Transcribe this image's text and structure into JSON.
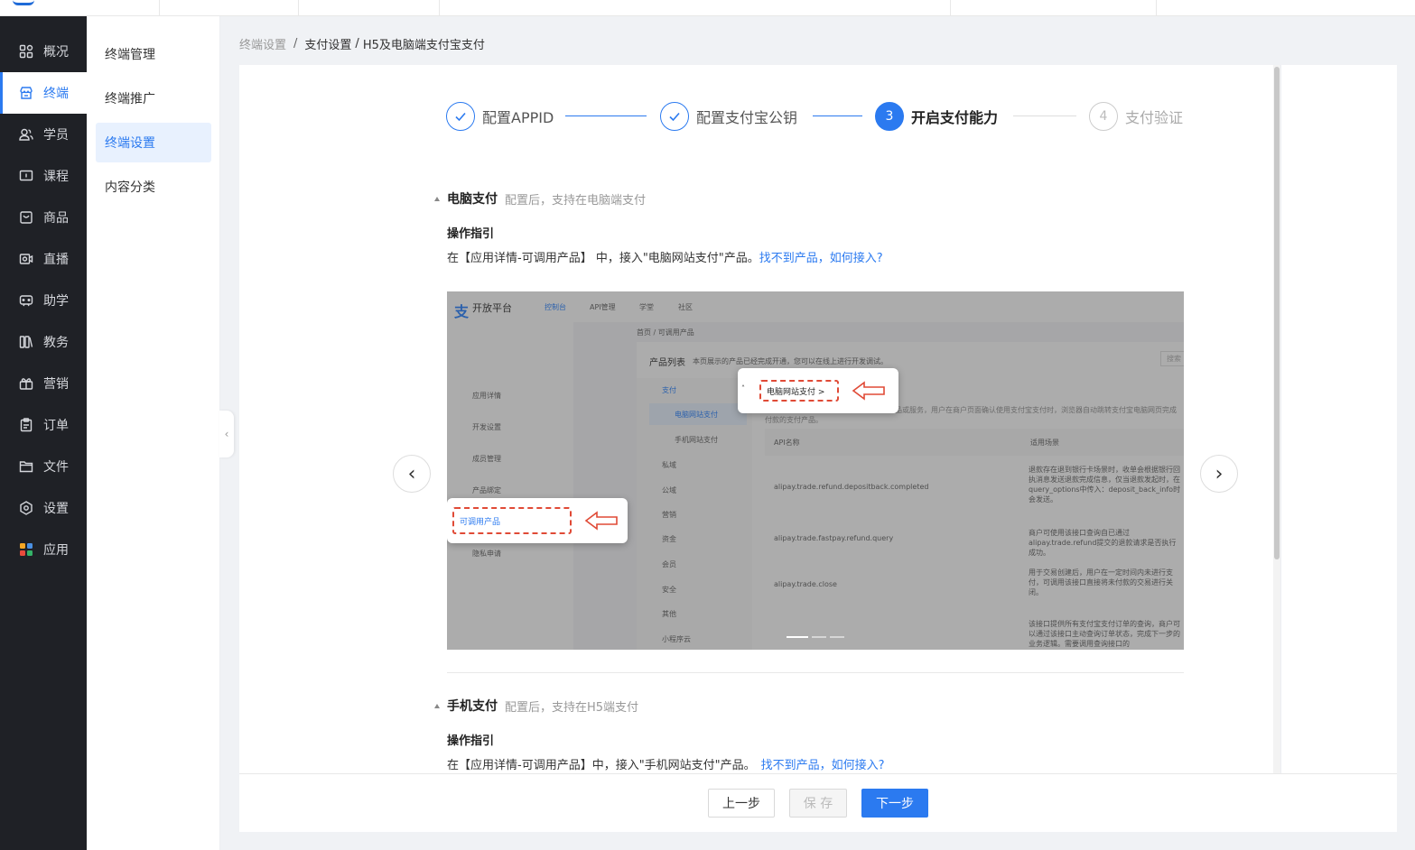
{
  "sidebar": {
    "items": [
      {
        "label": "概况",
        "icon": "grid-icon"
      },
      {
        "label": "终端",
        "icon": "store-icon"
      },
      {
        "label": "学员",
        "icon": "users-icon"
      },
      {
        "label": "课程",
        "icon": "course-icon"
      },
      {
        "label": "商品",
        "icon": "bag-icon"
      },
      {
        "label": "直播",
        "icon": "camera-icon"
      },
      {
        "label": "助学",
        "icon": "gamepad-icon"
      },
      {
        "label": "教务",
        "icon": "books-icon"
      },
      {
        "label": "营销",
        "icon": "gift-icon"
      },
      {
        "label": "订单",
        "icon": "clipboard-icon"
      },
      {
        "label": "文件",
        "icon": "folder-icon"
      },
      {
        "label": "设置",
        "icon": "gear-icon"
      },
      {
        "label": "应用",
        "icon": "apps-icon"
      }
    ],
    "active_index": 1
  },
  "subnav": {
    "items": [
      "终端管理",
      "终端推广",
      "终端设置",
      "内容分类"
    ],
    "active_index": 2
  },
  "breadcrumb": {
    "items": [
      "终端设置",
      "支付设置",
      "H5及电脑端支付宝支付"
    ],
    "sep": "/"
  },
  "steps": [
    {
      "num": "1",
      "label": "配置APPID",
      "state": "done"
    },
    {
      "num": "2",
      "label": "配置支付宝公钥",
      "state": "done"
    },
    {
      "num": "3",
      "label": "开启支付能力",
      "state": "current"
    },
    {
      "num": "4",
      "label": "支付验证",
      "state": "todo"
    }
  ],
  "pc_section": {
    "title": "电脑支付",
    "desc": "配置后，支持在电脑端支付",
    "guide_title": "操作指引",
    "guide_text": "在【应用详情-可调用产品】 中，接入\"电脑网站支付\"产品。",
    "guide_link": "找不到产品，如何接入?"
  },
  "mobile_section": {
    "title": "手机支付",
    "desc": "配置后，支持在H5端支付",
    "guide_title": "操作指引",
    "guide_text": "在【应用详情-可调用产品】中，接入\"手机网站支付\"产品。",
    "guide_link": "找不到产品，如何接入?"
  },
  "carousel": {
    "prev": "‹",
    "next": "›",
    "slide_count": 3,
    "active_slide": 0,
    "screenshot": {
      "brand": "开放平台",
      "nav": [
        "控制台",
        "API管理",
        "学堂",
        "社区"
      ],
      "left_menu": [
        "应用详情",
        "开发设置",
        "成员管理",
        "产品绑定",
        "可调用产品",
        "隐私申请"
      ],
      "crumb": "首页 / 可调用产品",
      "list_title": "产品列表",
      "list_desc": "本页展示的产品已经完成开通，您可以在线上进行开发调试。",
      "search_ph": "搜索",
      "categories": [
        "支付",
        "电脑网站支付",
        "手机网站支付",
        "私域",
        "公域",
        "营销",
        "资金",
        "会员",
        "安全",
        "其他",
        "小程序云"
      ],
      "callout_pc": "电脑网站支付 >",
      "callout_product": "可调用产品",
      "product_desc": "电脑网站支付是指商户在电脑网页展示商品或服务，用户在商户页面确认使用支付宝支付时，浏览器自动跳转支付宝电脑网页完成付款的支付产品。",
      "col_api": "API名称",
      "col_scene": "适用场景",
      "rows": [
        {
          "api": "alipay.trade.refund.depositback.completed",
          "scene": "退款存在退到银行卡场景时，收单会根据银行回执消息发送退款完成信息，仅当退款发起时，在query_options中传入：deposit_back_info时会发送。"
        },
        {
          "api": "alipay.trade.fastpay.refund.query",
          "scene": "商户可使用该接口查询自已通过alipay.trade.refund提交的退款请求是否执行成功。"
        },
        {
          "api": "alipay.trade.close",
          "scene": "用于交易创建后，用户在一定时间内未进行支付，可调用该接口直接将未付款的交易进行关闭。"
        },
        {
          "api": "",
          "scene": "该接口提供所有支付宝支付订单的查询，商户可以通过该接口主动查询订单状态，完成下一步的业务逻辑。需要调用查询接口的"
        }
      ]
    }
  },
  "footer": {
    "prev_label": "上一步",
    "save_label": "保 存",
    "next_label": "下一步"
  },
  "colors": {
    "primary": "#2b7af0",
    "sidebar_bg": "#1f2126",
    "callout_red": "#e04a36"
  }
}
